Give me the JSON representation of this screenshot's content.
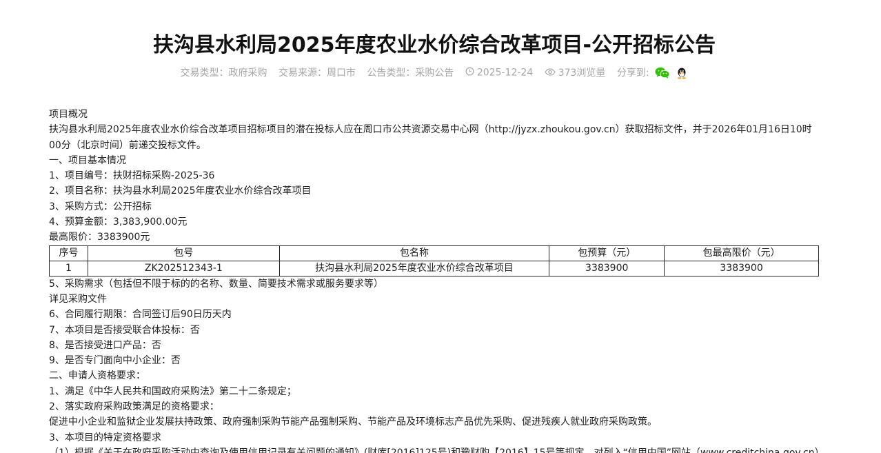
{
  "title": "扶沟县水利局2025年度农业水价综合改革项目-公开招标公告",
  "meta": {
    "trade_type": "交易类型：政府采购",
    "trade_source": "交易来源：周口市",
    "notice_type": "公告类型：采购公告",
    "date": "2025-12-24",
    "views": "373浏览量",
    "share_label": "分享到:",
    "colors": {
      "meta_text": "#a6a6a6",
      "wechat": "#2dc100",
      "qq_body": "#111111"
    }
  },
  "content": {
    "overview_heading": "项目概况",
    "overview_text": "扶沟县水利局2025年度农业水价综合改革项目招标项目的潜在投标人应在周口市公共资源交易中心网（http://jyzx.zhoukou.gov.cn）获取招标文件，并于2026年01月16日10时00分（北京时间）前递交投标文件。",
    "section1": "一、项目基本情况",
    "item1": "1、项目编号：扶财招标采购-2025-36",
    "item2": "2、项目名称：扶沟县水利局2025年度农业水价综合改革项目",
    "item3": "3、采购方式：公开招标",
    "item4": "4、预算金额：3,383,900.00元",
    "max_price": "最高限价：3383900元",
    "table": {
      "headers": [
        "序号",
        "包号",
        "包名称",
        "包预算（元）",
        "包最高限价（元）"
      ],
      "rows": [
        [
          "1",
          "ZK202512343-1",
          "扶沟县水利局2025年度农业水价综合改革项目",
          "3383900",
          "3383900"
        ]
      ]
    },
    "item5": "5、采购需求（包括但不限于标的的名称、数量、简要技术需求或服务要求等）",
    "item5_detail": "详见采购文件",
    "item6": "6、合同履行期限：合同签订后90日历天内",
    "item7": "7、本项目是否接受联合体投标：否",
    "item8": "8、是否接受进口产品：否",
    "item9": "9、是否专门面向中小企业：否",
    "section2": "二、申请人资格要求：",
    "req1": "1、满足《中华人民共和国政府采购法》第二十二条规定；",
    "req2": "2、落实政府采购政策满足的资格要求：",
    "req2_detail": "促进中小企业和监狱企业发展扶持政策、政府强制采购节能产品强制采购、节能产品及环境标志产品优先采购、促进残疾人就业政府采购政策。",
    "req3": "3、本项目的特定资格要求",
    "req3_cut": "（1）根据《关于在政府采购活动中查询及使用信用记录有关问题的通知》(财库[2016]125号)和豫财购【2016】15号等规定，对列入“信用中国”网站（www.creditchina.gov.cn）"
  }
}
